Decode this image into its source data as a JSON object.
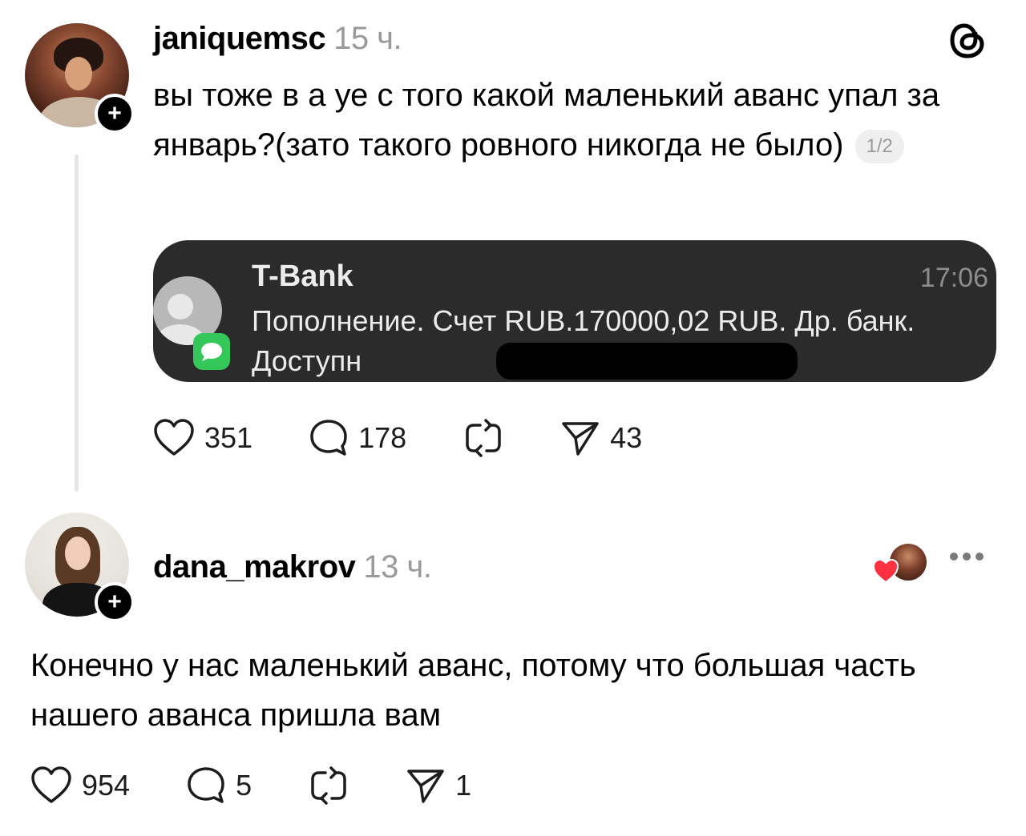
{
  "post": {
    "username": "janiquemsc",
    "time": "15 ч.",
    "text": "вы тоже в а  уе с того какой маленький аванс упал за январь?(зато такого ровного никогда не было)",
    "page_indicator": "1/2",
    "notification": {
      "sender": "T-Bank",
      "time": "17:06",
      "body": "Пополнение. Счет RUB.170000,02 RUB. Др. банк. Доступн"
    },
    "likes": "351",
    "replies": "178",
    "shares": "43"
  },
  "reply": {
    "username": "dana_makrov",
    "time": "13 ч.",
    "text": "Конечно у нас маленький аванс, потому что большая часть нашего аванса пришла вам",
    "likes": "954",
    "replies": "5",
    "shares": "1"
  },
  "icons": {
    "follow": "plus",
    "logo": "threads-logo",
    "like": "heart-outline-icon",
    "comment": "speech-bubble-icon",
    "repost": "repost-icon",
    "share": "paper-plane-icon",
    "more": "ellipsis-icon"
  },
  "colors": {
    "background": "#ffffff",
    "text": "#000000",
    "muted": "#9a9a9a",
    "card": "#2b2b2b",
    "sms_green": "#34c759",
    "heart_red": "#ff3040"
  }
}
